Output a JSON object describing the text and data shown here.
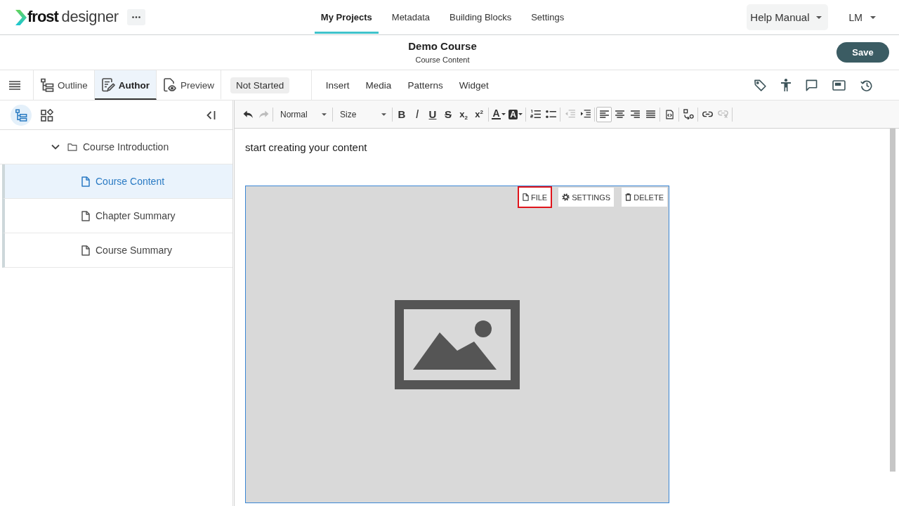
{
  "header": {
    "logo": "**frost** designer",
    "nav": [
      {
        "label": "My Projects",
        "selected": true
      },
      {
        "label": "Metadata",
        "selected": false
      },
      {
        "label": "Building Blocks",
        "selected": false
      },
      {
        "label": "Settings",
        "selected": false
      }
    ],
    "help_menu": "Help Manual",
    "user_menu": "LM"
  },
  "course_bar": {
    "title": "Demo Course",
    "subtitle": "Course Content",
    "save_button": "Save"
  },
  "mode_bar": {
    "tabs": [
      {
        "kind": "outline",
        "label": "Outline",
        "selected": false
      },
      {
        "kind": "author",
        "label": "Author",
        "selected": true
      },
      {
        "kind": "preview",
        "label": "Preview",
        "selected": false
      }
    ],
    "status": "Not Started",
    "menu": [
      "Insert",
      "Media",
      "Patterns",
      "Widget"
    ]
  },
  "sidebar": {
    "views": [
      {
        "kind": "tree",
        "selected": true
      },
      {
        "kind": "blocks",
        "selected": false
      }
    ],
    "tree": [
      {
        "kind": "folder",
        "label": "Course Introduction",
        "expanded": true,
        "selected": false,
        "children": [
          {
            "kind": "page",
            "label": "Course Content",
            "selected": true
          },
          {
            "kind": "page",
            "label": "Chapter Summary",
            "selected": false
          },
          {
            "kind": "page",
            "label": "Course Summary",
            "selected": false
          }
        ]
      }
    ]
  },
  "editor": {
    "toolbar_groups": [
      [
        {
          "kind": "undo",
          "disabled": false
        },
        {
          "kind": "redo",
          "disabled": true
        }
      ],
      [
        {
          "kind": "format-select",
          "label": "Normal"
        }
      ],
      [
        {
          "kind": "size-select",
          "label": "Size"
        }
      ],
      [
        {
          "kind": "bold",
          "label": "B"
        },
        {
          "kind": "italic",
          "label": "I"
        },
        {
          "kind": "underline",
          "label": "U"
        },
        {
          "kind": "strike",
          "label": "S"
        },
        {
          "kind": "subscript",
          "label": "x$_{2}$"
        },
        {
          "kind": "superscript",
          "label": "x$^{2}$"
        }
      ],
      [
        {
          "kind": "text-color",
          "label": "A"
        },
        {
          "kind": "background-color",
          "label": "A"
        }
      ],
      [
        {
          "kind": "numbered-list"
        },
        {
          "kind": "bullet-list"
        }
      ],
      [
        {
          "kind": "outdent",
          "disabled": true
        },
        {
          "kind": "indent",
          "disabled": false
        }
      ],
      [
        {
          "kind": "align-left",
          "selected": true
        },
        {
          "kind": "align-center",
          "selected": false
        },
        {
          "kind": "align-right",
          "selected": false
        },
        {
          "kind": "justify",
          "selected": false
        }
      ],
      [
        {
          "kind": "source"
        }
      ],
      [
        {
          "kind": "text-direction"
        }
      ],
      [
        {
          "kind": "link",
          "disabled": false
        },
        {
          "kind": "unlink",
          "disabled": true
        }
      ]
    ],
    "paragraph": "start creating your content",
    "image_block": {
      "actions": [
        {
          "kind": "file",
          "label": "FILE",
          "highlighted": true
        },
        {
          "kind": "settings",
          "label": "SETTINGS",
          "highlighted": false
        },
        {
          "kind": "delete",
          "label": "DELETE",
          "highlighted": false
        }
      ]
    }
  }
}
